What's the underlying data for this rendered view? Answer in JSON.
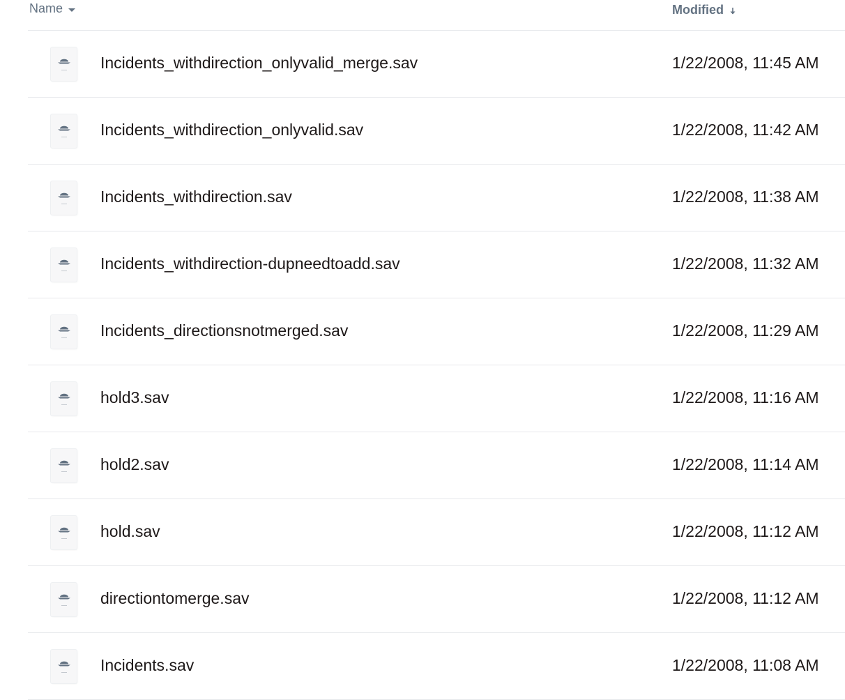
{
  "header": {
    "name_label": "Name",
    "modified_label": "Modified"
  },
  "files": [
    {
      "name": "Incidents_withdirection_onlyvalid_merge.sav",
      "modified": "1/22/2008, 11:45 AM",
      "icon": "spss-file-icon"
    },
    {
      "name": "Incidents_withdirection_onlyvalid.sav",
      "modified": "1/22/2008, 11:42 AM",
      "icon": "spss-file-icon"
    },
    {
      "name": "Incidents_withdirection.sav",
      "modified": "1/22/2008, 11:38 AM",
      "icon": "spss-file-icon"
    },
    {
      "name": "Incidents_withdirection-dupneedtoadd.sav",
      "modified": "1/22/2008, 11:32 AM",
      "icon": "spss-file-icon"
    },
    {
      "name": "Incidents_directionsnotmerged.sav",
      "modified": "1/22/2008, 11:29 AM",
      "icon": "spss-file-icon"
    },
    {
      "name": "hold3.sav",
      "modified": "1/22/2008, 11:16 AM",
      "icon": "spss-file-icon"
    },
    {
      "name": "hold2.sav",
      "modified": "1/22/2008, 11:14 AM",
      "icon": "spss-file-icon"
    },
    {
      "name": "hold.sav",
      "modified": "1/22/2008, 11:12 AM",
      "icon": "spss-file-icon"
    },
    {
      "name": "directiontomerge.sav",
      "modified": "1/22/2008, 11:12 AM",
      "icon": "spss-file-icon"
    },
    {
      "name": "Incidents.sav",
      "modified": "1/22/2008, 11:08 AM",
      "icon": "spss-file-icon"
    }
  ]
}
